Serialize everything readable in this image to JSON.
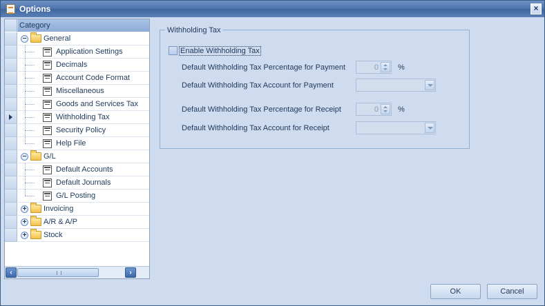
{
  "window": {
    "title": "Options"
  },
  "tree": {
    "header": "Category",
    "items": [
      {
        "label": "General",
        "type": "group",
        "expander": "−"
      },
      {
        "label": "Application Settings",
        "type": "leaf"
      },
      {
        "label": "Decimals",
        "type": "leaf"
      },
      {
        "label": "Account Code Format",
        "type": "leaf"
      },
      {
        "label": "Miscellaneous",
        "type": "leaf"
      },
      {
        "label": "Goods and Services Tax",
        "type": "leaf"
      },
      {
        "label": "Withholding Tax",
        "type": "leaf",
        "selected": true
      },
      {
        "label": "Security Policy",
        "type": "leaf"
      },
      {
        "label": "Help File",
        "type": "leaf"
      },
      {
        "label": "G/L",
        "type": "group",
        "expander": "−"
      },
      {
        "label": "Default Accounts",
        "type": "leaf"
      },
      {
        "label": "Default Journals",
        "type": "leaf"
      },
      {
        "label": "G/L Posting",
        "type": "leaf"
      },
      {
        "label": "Invoicing",
        "type": "group",
        "expander": "+"
      },
      {
        "label": "A/R & A/P",
        "type": "group",
        "expander": "+"
      },
      {
        "label": "Stock",
        "type": "group",
        "expander": "+"
      }
    ]
  },
  "withholding": {
    "group_title": "Withholding Tax",
    "enable_label": "Enable Withholding Tax",
    "enable_checked": false,
    "payment_pct_label": "Default Withholding Tax Percentage for Payment",
    "payment_pct_value": "0",
    "payment_account_label": "Default Withholding Tax Account for Payment",
    "receipt_pct_label": "Default Withholding Tax Percentage for Receipt",
    "receipt_pct_value": "0",
    "receipt_account_label": "Default Withholding Tax Account for Receipt",
    "percent_symbol": "%"
  },
  "buttons": {
    "ok": "OK",
    "cancel": "Cancel"
  },
  "colors": {
    "titlebar": "#4c72a9",
    "background": "#cfdbee",
    "selection": "#8facd8"
  }
}
